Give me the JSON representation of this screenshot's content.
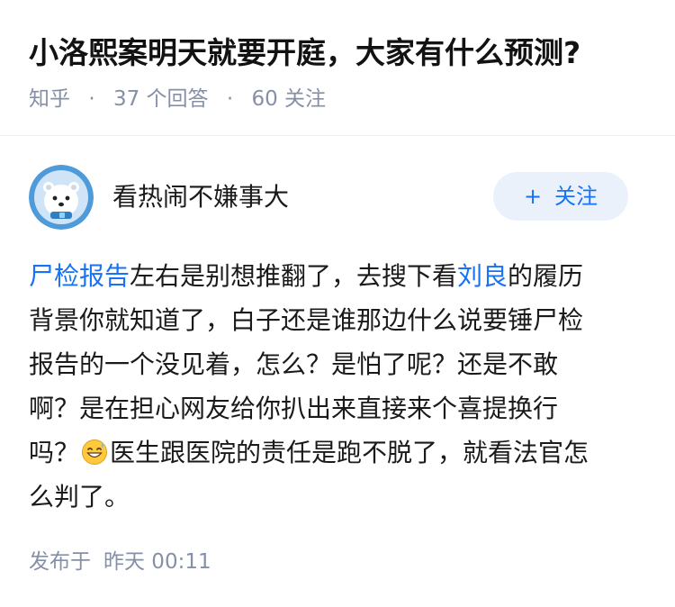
{
  "question": {
    "title": "小洛熙案明天就要开庭，大家有什么预测?",
    "source": "知乎",
    "answer_count": "37 个回答",
    "follower_count": "60 关注",
    "separator": "·"
  },
  "answer": {
    "author_name": "看热闹不嫌事大",
    "follow_plus": "+",
    "follow_label": "关注",
    "lines": {
      "l1_link1": "尸检报告",
      "l1_text1": "左右是别想推翻了，去搜下看",
      "l1_link2": "刘良",
      "l1_text2": "的履历",
      "l2": "背景你就知道了，白子还是谁那边什么说要锤尸检",
      "l3": "报告的一个没见着，怎么？是怕了呢？还是不敢",
      "l4": "啊？是在担心网友给你扒出来直接来个喜提换行",
      "l5_before": "吗？",
      "l5_after": "医生跟医院的责任是跑不脱了，就看法官怎",
      "l6": "么判了。"
    },
    "emoji_icon": "grinning-sweat-emoji",
    "published_label": "发布于",
    "published_time": "昨天 00:11"
  },
  "colors": {
    "link": "#1772f6",
    "meta": "#8590a6",
    "follow_bg": "#eaf1fb",
    "avatar_bg": "#4f9bd9"
  }
}
